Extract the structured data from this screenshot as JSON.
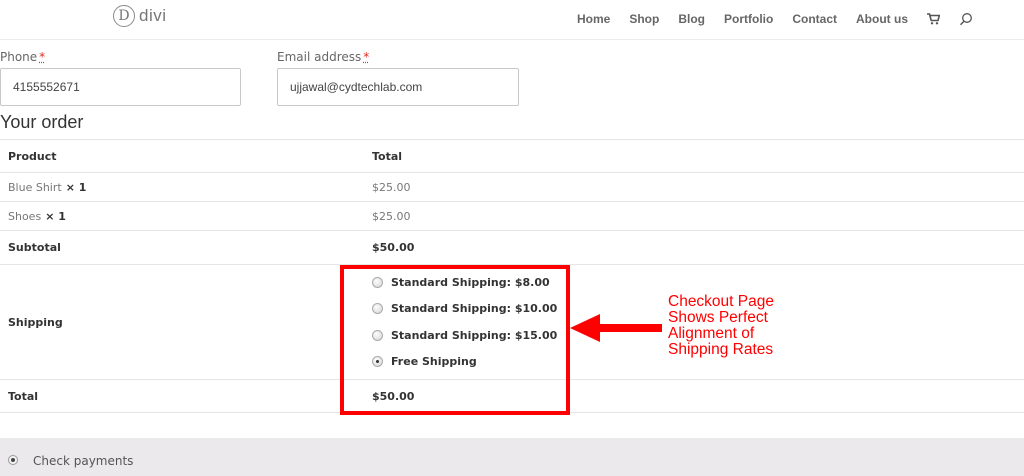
{
  "header": {
    "logo_letter": "D",
    "logo_text": "divi",
    "nav": [
      "Home",
      "Shop",
      "Blog",
      "Portfolio",
      "Contact",
      "About us"
    ],
    "icons": [
      "cart-icon",
      "search-icon"
    ]
  },
  "fields": {
    "phone": {
      "label": "Phone",
      "required": "*",
      "value": "4155552671"
    },
    "email": {
      "label": "Email address",
      "required": "*",
      "value": "ujjawal@cydtechlab.com"
    }
  },
  "order": {
    "title": "Your order",
    "headers": {
      "product": "Product",
      "total": "Total"
    },
    "items": [
      {
        "name": "Blue Shirt",
        "qty": "× 1",
        "total": "$25.00"
      },
      {
        "name": "Shoes",
        "qty": "× 1",
        "total": "$25.00"
      }
    ],
    "subtotal": {
      "label": "Subtotal",
      "value": "$50.00"
    },
    "shipping": {
      "label": "Shipping",
      "options": [
        {
          "label": "Standard Shipping: $8.00",
          "selected": false
        },
        {
          "label": "Standard Shipping: $10.00",
          "selected": false
        },
        {
          "label": "Standard Shipping: $15.00",
          "selected": false
        },
        {
          "label": "Free Shipping",
          "selected": true
        }
      ]
    },
    "total": {
      "label": "Total",
      "value": "$50.00"
    }
  },
  "annotation": {
    "text": "Checkout Page\nShows Perfect\nAlignment of\nShipping Rates",
    "color": "#ff0000"
  },
  "payments": {
    "label": "Check payments",
    "selected": true
  }
}
